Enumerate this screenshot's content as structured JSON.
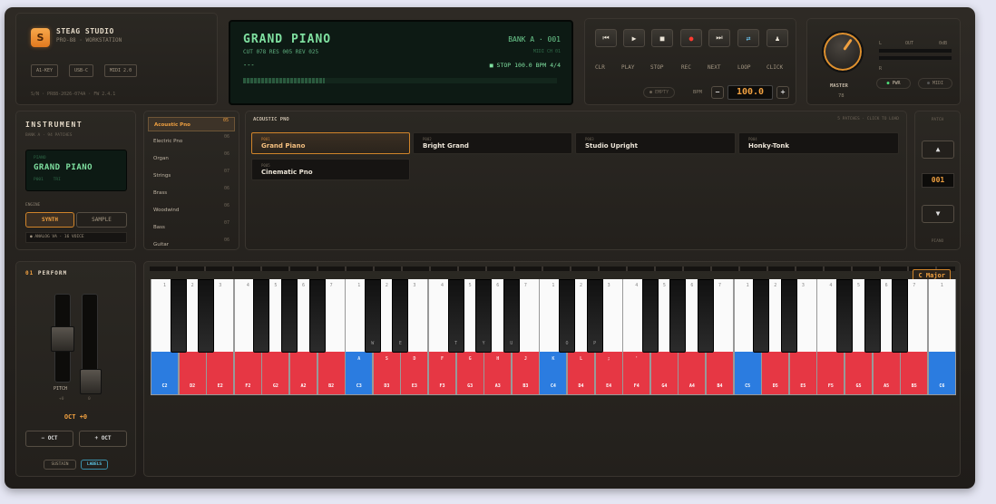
{
  "brand": {
    "name": "STEAG STUDIO",
    "sub": "PRO-88 · WORKSTATION",
    "logo": "S",
    "tags": [
      "A1-KEY",
      "USB-C",
      "MIDI 2.0"
    ],
    "serial": "S/N · PR88-2026-074A · FW 2.4.1"
  },
  "lcd": {
    "title": "GRAND PIANO",
    "params": "CUT 078 RES 005 REV 025",
    "line3": "---",
    "bank": "BANK A · 001",
    "midi": "MIDI CH 01",
    "status": "■ STOP 100.0 BPM 4/4"
  },
  "transport": {
    "buttons": [
      {
        "icon": "⏮",
        "label": "CLR"
      },
      {
        "icon": "▶",
        "label": "PLAY"
      },
      {
        "icon": "■",
        "label": "STOP"
      },
      {
        "icon": "●",
        "label": "REC"
      },
      {
        "icon": "⏭",
        "label": "NEXT"
      },
      {
        "icon": "⇄",
        "label": "LOOP"
      },
      {
        "icon": "♟",
        "label": "CLICK"
      }
    ],
    "empty": "EMPTY",
    "bpm_label": "BPM",
    "bpm_value": "100.0",
    "minus": "−",
    "plus": "+"
  },
  "master": {
    "label": "MASTER",
    "value": "78",
    "out_l": "L",
    "out": "OUT",
    "out_db": "0dB",
    "out_r": "R",
    "pwr": "PWR",
    "midi": "MIDI"
  },
  "instrument": {
    "title": "INSTRUMENT",
    "sub": "BANK A · 94 PATCHES",
    "lcd_cat": "PIANO",
    "lcd_name": "GRAND PIANO",
    "lcd_meta": "P001    TRI",
    "engine_label": "ENGINE",
    "synth": "SYNTH",
    "sample": "SAMPLE",
    "voice": "● ANALOG VA · 16 VOICE"
  },
  "categories": [
    {
      "name": "Acoustic Pno",
      "count": "05"
    },
    {
      "name": "Electric Pno",
      "count": "06"
    },
    {
      "name": "Organ",
      "count": "06"
    },
    {
      "name": "Strings",
      "count": "07"
    },
    {
      "name": "Brass",
      "count": "06"
    },
    {
      "name": "Woodwind",
      "count": "06"
    },
    {
      "name": "Bass",
      "count": "07"
    },
    {
      "name": "Guitar",
      "count": "06"
    }
  ],
  "patches": {
    "header": "ACOUSTIC PNO",
    "info": "5 PATCHES · CLICK TO LOAD",
    "items": [
      {
        "num": "P001",
        "name": "Grand Piano"
      },
      {
        "num": "P002",
        "name": "Bright Grand"
      },
      {
        "num": "P003",
        "name": "Studio Upright"
      },
      {
        "num": "P004",
        "name": "Honky-Tonk"
      },
      {
        "num": "P005",
        "name": "Cinematic Pno"
      }
    ]
  },
  "patch_nav": {
    "label": "PATCH",
    "up": "▲",
    "value": "001",
    "down": "▼",
    "cat": "PIANO"
  },
  "perform": {
    "title": "PERFORM",
    "num": "01",
    "pitch": "PITCH",
    "pitch_val": "+0",
    "mod_val": "0",
    "oct": "OCT +0",
    "oct_down": "− OCT",
    "oct_up": "+ OCT",
    "sustain": "SUSTAIN",
    "labels": "LABELS"
  },
  "keyboard": {
    "scale": "C Major",
    "white": [
      {
        "n": "1",
        "c": "C2",
        "b": true
      },
      {
        "n": "2",
        "c": "D2"
      },
      {
        "n": "3",
        "c": "E2"
      },
      {
        "n": "4",
        "c": "F2"
      },
      {
        "n": "5",
        "c": "G2"
      },
      {
        "n": "6",
        "c": "A2"
      },
      {
        "n": "7",
        "c": "B2"
      },
      {
        "n": "1",
        "c": "C3",
        "k": "A",
        "b": true
      },
      {
        "n": "2",
        "c": "D3",
        "k": "S"
      },
      {
        "n": "3",
        "c": "E3",
        "k": "D"
      },
      {
        "n": "4",
        "c": "F3",
        "k": "F"
      },
      {
        "n": "5",
        "c": "G3",
        "k": "G"
      },
      {
        "n": "6",
        "c": "A3",
        "k": "H"
      },
      {
        "n": "7",
        "c": "B3",
        "k": "J"
      },
      {
        "n": "1",
        "c": "C4",
        "k": "K",
        "b": true
      },
      {
        "n": "2",
        "c": "D4",
        "k": "L"
      },
      {
        "n": "3",
        "c": "E4",
        "k": ";"
      },
      {
        "n": "4",
        "c": "F4",
        "k": "'"
      },
      {
        "n": "5",
        "c": "G4"
      },
      {
        "n": "6",
        "c": "A4"
      },
      {
        "n": "7",
        "c": "B4"
      },
      {
        "n": "1",
        "c": "C5",
        "b": true
      },
      {
        "n": "2",
        "c": "D5"
      },
      {
        "n": "3",
        "c": "E5"
      },
      {
        "n": "4",
        "c": "F5"
      },
      {
        "n": "5",
        "c": "G5"
      },
      {
        "n": "6",
        "c": "A5"
      },
      {
        "n": "7",
        "c": "B5"
      },
      {
        "n": "1",
        "c": "C6",
        "b": true
      }
    ],
    "black": [
      {
        "n": "",
        "l": ""
      },
      {
        "n": "",
        "l": ""
      },
      {
        "n": "",
        "l": ""
      },
      {
        "n": "",
        "l": ""
      },
      {
        "n": "",
        "l": ""
      },
      {
        "n": "",
        "l": "W"
      },
      {
        "n": "",
        "l": "E"
      },
      {
        "n": "",
        "l": "T"
      },
      {
        "n": "",
        "l": "Y"
      },
      {
        "n": "",
        "l": "U"
      },
      {
        "n": "",
        "l": "O"
      },
      {
        "n": "",
        "l": "P"
      },
      {
        "n": "",
        "l": ""
      },
      {
        "n": "",
        "l": ""
      },
      {
        "n": "",
        "l": ""
      },
      {
        "n": "",
        "l": ""
      },
      {
        "n": "",
        "l": ""
      },
      {
        "n": "",
        "l": ""
      },
      {
        "n": "",
        "l": ""
      },
      {
        "n": "",
        "l": ""
      }
    ]
  }
}
